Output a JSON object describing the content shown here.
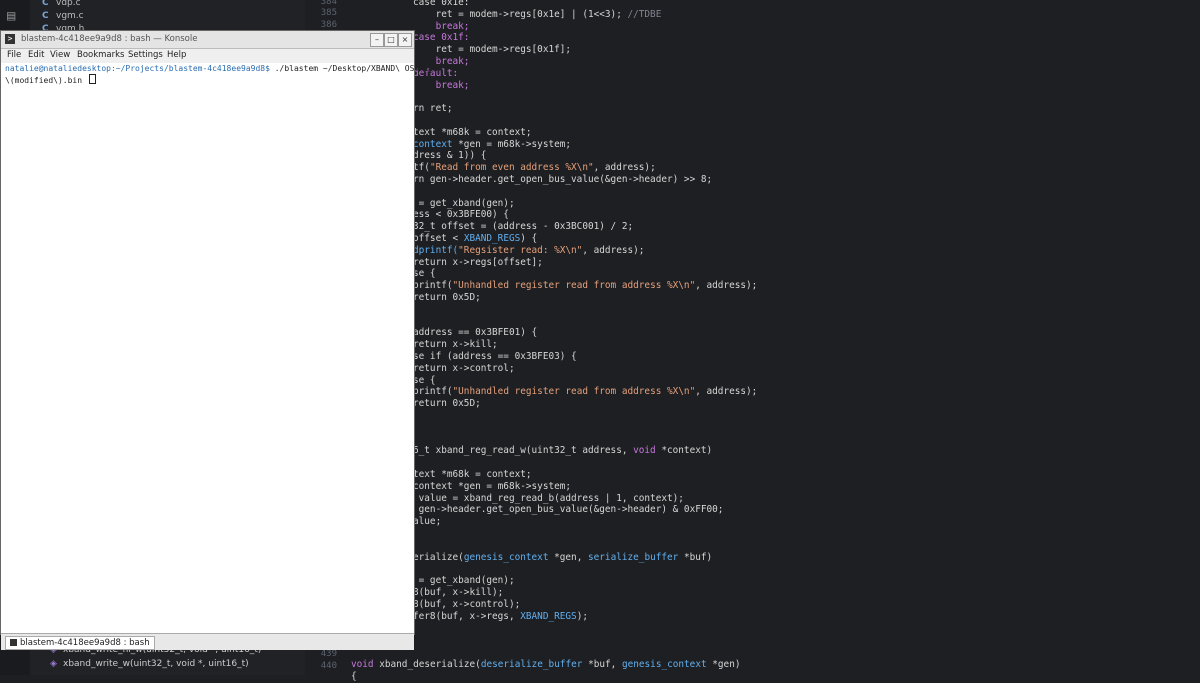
{
  "sidebar": {
    "files": [
      {
        "icon": "C",
        "name": "vdp.c"
      },
      {
        "icon": "C",
        "name": "vgm.c"
      },
      {
        "icon": "C",
        "name": "vgm.h"
      }
    ],
    "symbols": [
      "xband_write_hi_w(uint32_t, void *, uint16_t)",
      "xband_write_w(uint32_t, void *, uint16_t)"
    ]
  },
  "editor": {
    "line_numbers_top": [
      "384",
      "385",
      "386"
    ],
    "line_numbers_bottom": [
      "439",
      "440"
    ],
    "lines": [
      [
        [
          "case 0x1e:",
          ""
        ]
      ],
      [
        [
          "    ret = modem->regs[0x1e] | (1<<3); ",
          ""
        ],
        [
          "//TDBE",
          "c"
        ]
      ],
      [
        [
          "    break;",
          "k"
        ]
      ],
      [
        [
          "case 0x1f:",
          "k"
        ]
      ],
      [
        [
          "    ret = modem->regs[0x1f];",
          ""
        ]
      ],
      [
        [
          "    break;",
          "k"
        ]
      ],
      [
        [
          "default:",
          "k"
        ]
      ],
      [
        [
          "    break;",
          "k"
        ]
      ],
      [
        [
          "",
          ""
        ]
      ],
      [
        [
          "rn ret;",
          ""
        ]
      ],
      [
        [
          "",
          ""
        ]
      ],
      [
        [
          "text ",
          ""
        ],
        [
          "*m68k",
          ""
        ],
        [
          " = context;",
          ""
        ]
      ],
      [
        [
          "context ",
          "t"
        ],
        [
          "*gen = m68k->system;",
          ""
        ]
      ],
      [
        [
          "dress & 1)) {",
          ""
        ]
      ],
      [
        [
          "tf(",
          ""
        ],
        [
          "\"Read from even address %X\\n\"",
          "s"
        ],
        [
          ", address);",
          ""
        ]
      ],
      [
        [
          "rn gen->header.get_open_bus_value(&gen->header) >> 8;",
          ""
        ]
      ],
      [
        [
          "",
          ""
        ]
      ],
      [
        [
          " = get_xband(gen);",
          ""
        ]
      ],
      [
        [
          "ess < 0x3BFE00) {",
          ""
        ]
      ],
      [
        [
          "32_t offset = (address - 0x3BC001) / 2;",
          ""
        ]
      ],
      [
        [
          "offset < ",
          ""
        ],
        [
          "XBAND_REGS",
          "t"
        ],
        [
          ") {",
          ""
        ]
      ],
      [
        [
          "dprintf(",
          "t"
        ],
        [
          "\"Regsister read: %X\\n\"",
          "s"
        ],
        [
          ", address);",
          ""
        ]
      ],
      [
        [
          "return x->regs[offset];",
          ""
        ]
      ],
      [
        [
          "se {",
          ""
        ]
      ],
      [
        [
          "printf(",
          ""
        ],
        [
          "\"Unhandled register read from address %X\\n\"",
          "s"
        ],
        [
          ", address);",
          ""
        ]
      ],
      [
        [
          "return 0x5D;",
          ""
        ]
      ],
      [
        [
          "",
          ""
        ]
      ],
      [
        [
          "",
          ""
        ]
      ],
      [
        [
          "address == 0x3BFE01) {",
          ""
        ]
      ],
      [
        [
          "return x->kill;",
          ""
        ]
      ],
      [
        [
          "se if (address == 0x3BFE03) {",
          ""
        ]
      ],
      [
        [
          "return x->control;",
          ""
        ]
      ],
      [
        [
          "se {",
          ""
        ]
      ],
      [
        [
          "printf(",
          ""
        ],
        [
          "\"Unhandled register read from address %X\\n\"",
          "s"
        ],
        [
          ", address);",
          ""
        ]
      ],
      [
        [
          "return 0x5D;",
          ""
        ]
      ],
      [
        [
          "",
          ""
        ]
      ],
      [
        [
          "",
          ""
        ]
      ],
      [
        [
          "",
          ""
        ]
      ],
      [
        [
          "6_t xband_reg_read_w(uint32_t address, ",
          ""
        ],
        [
          "void",
          "k"
        ],
        [
          " *context)",
          ""
        ]
      ],
      [
        [
          "",
          ""
        ]
      ],
      [
        [
          "text *m68k = context;",
          ""
        ]
      ],
      [
        [
          "context *gen = m68k->system;",
          ""
        ]
      ],
      [
        [
          " value = xband_reg_read_b(address | 1, context);",
          ""
        ]
      ],
      [
        [
          " gen->header.get_open_bus_value(&gen->header) & 0xFF00;",
          ""
        ]
      ],
      [
        [
          "alue;",
          ""
        ]
      ],
      [
        [
          "",
          ""
        ]
      ],
      [
        [
          "",
          ""
        ]
      ],
      [
        [
          "erialize(",
          ""
        ],
        [
          "genesis_context",
          "t"
        ],
        [
          " *gen, ",
          ""
        ],
        [
          "serialize_buffer",
          "t"
        ],
        [
          " *buf)",
          ""
        ]
      ],
      [
        [
          "",
          ""
        ]
      ],
      [
        [
          " = get_xband(gen);",
          ""
        ]
      ],
      [
        [
          "8(buf, x->kill);",
          ""
        ]
      ],
      [
        [
          "8(buf, x->control);",
          ""
        ]
      ],
      [
        [
          "fer8(buf, x->regs, ",
          ""
        ],
        [
          "XBAND_REGS",
          "t"
        ],
        [
          ");",
          ""
        ]
      ]
    ],
    "bottom_line": [
      [
        "void",
        "k"
      ],
      [
        " xband_deserialize(",
        ""
      ],
      [
        "deserialize_buffer",
        "t"
      ],
      [
        " *buf, ",
        ""
      ],
      [
        "genesis_context",
        "t"
      ],
      [
        " *gen)",
        ""
      ]
    ],
    "last_line": "{"
  },
  "konsole": {
    "title": "blastem-4c418ee9a9d8 : bash — Konsole",
    "menu": [
      "File",
      "Edit",
      "View",
      "Bookmarks",
      "Settings",
      "Help"
    ],
    "prompt": "natalie@nataliedesktop:~/Projects/blastem-4c418ee9a9d8$",
    "command": " ./blastem ~/Desktop/XBAND\\ OS\\ 1.0\\",
    "command_cont": "\\(modified\\).bin ",
    "tab_label": "blastem-4c418ee9a9d8 : bash"
  }
}
